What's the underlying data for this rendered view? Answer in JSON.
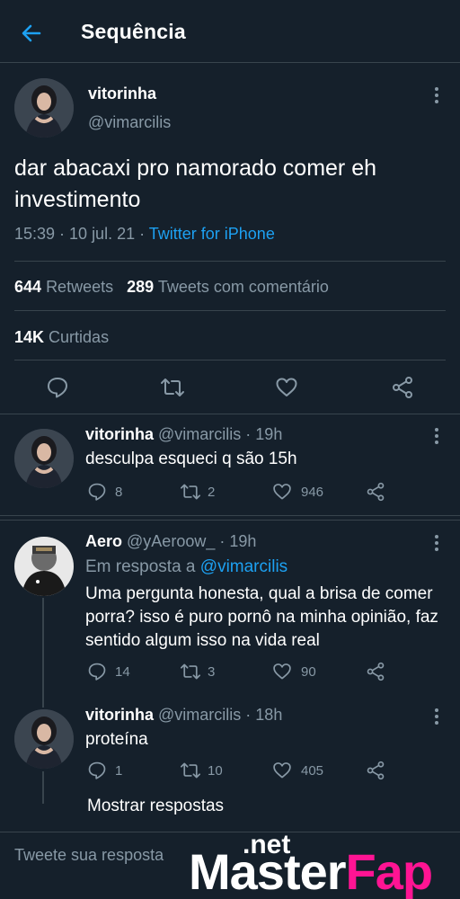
{
  "header": {
    "title": "Sequência"
  },
  "main_tweet": {
    "display_name": "vitorinha",
    "handle": "@vimarcilis",
    "text": "dar abacaxi pro namorado comer eh investimento",
    "time": "15:39 · 10 jul. 21 · ",
    "source": "Twitter for iPhone",
    "retweets_count": "644",
    "retweets_label": "Retweets",
    "quotes_count": "289",
    "quotes_label": "Tweets com comentário",
    "likes_count": "14K",
    "likes_label": "Curtidas"
  },
  "replies": [
    {
      "display_name": "vitorinha",
      "meta": "@vimarcilis · 19h",
      "text": "desculpa esqueci q são 15h",
      "comments": "8",
      "retweets": "2",
      "likes": "946"
    },
    {
      "display_name": "Aero",
      "meta": "@yAeroow_ · 19h",
      "reply_prefix": "Em resposta a ",
      "reply_to": "@vimarcilis",
      "text": "Uma pergunta honesta, qual a brisa de comer porra? isso é puro pornô na minha opinião, faz sentido algum isso na vida real",
      "comments": "14",
      "retweets": "3",
      "likes": "90"
    },
    {
      "display_name": "vitorinha",
      "meta": "@vimarcilis · 18h",
      "text": "proteína",
      "comments": "1",
      "retweets": "10",
      "likes": "405"
    }
  ],
  "show_replies": "Mostrar respostas",
  "compose": {
    "placeholder": "Tweete sua resposta"
  },
  "watermark": {
    "net": ".net",
    "master": "Master",
    "fap": "Fap"
  },
  "colors": {
    "background": "#15202b",
    "accent": "#1da1f2",
    "muted": "#8899a6",
    "divider": "#38444d"
  }
}
